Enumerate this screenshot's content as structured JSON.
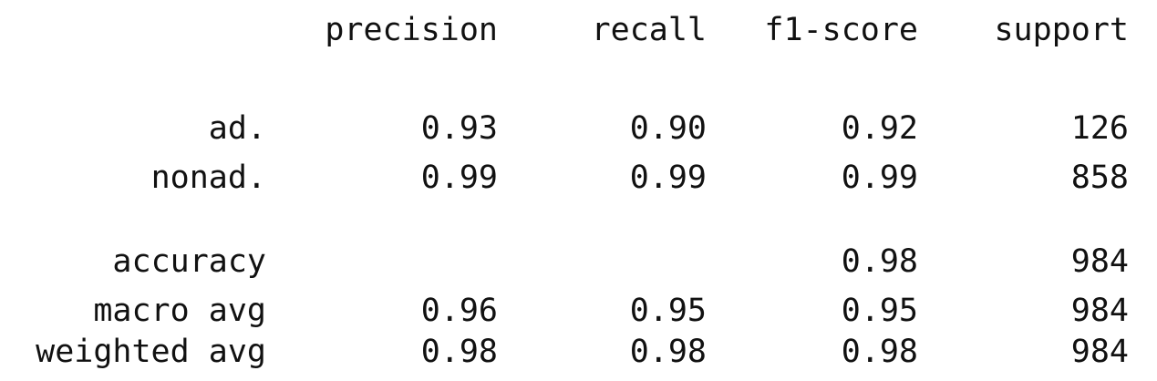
{
  "header": {
    "precision": "precision",
    "recall": "recall",
    "f1": "f1-score",
    "support": "support"
  },
  "class_rows": [
    {
      "label": "ad.",
      "precision": "0.93",
      "recall": "0.90",
      "f1": "0.92",
      "support": "126"
    },
    {
      "label": "nonad.",
      "precision": "0.99",
      "recall": "0.99",
      "f1": "0.99",
      "support": "858"
    }
  ],
  "summary_rows": [
    {
      "label": "accuracy",
      "precision": "",
      "recall": "",
      "f1": "0.98",
      "support": "984"
    },
    {
      "label": "macro avg",
      "precision": "0.96",
      "recall": "0.95",
      "f1": "0.95",
      "support": "984"
    },
    {
      "label": "weighted avg",
      "precision": "0.98",
      "recall": "0.98",
      "f1": "0.98",
      "support": "984"
    }
  ]
}
